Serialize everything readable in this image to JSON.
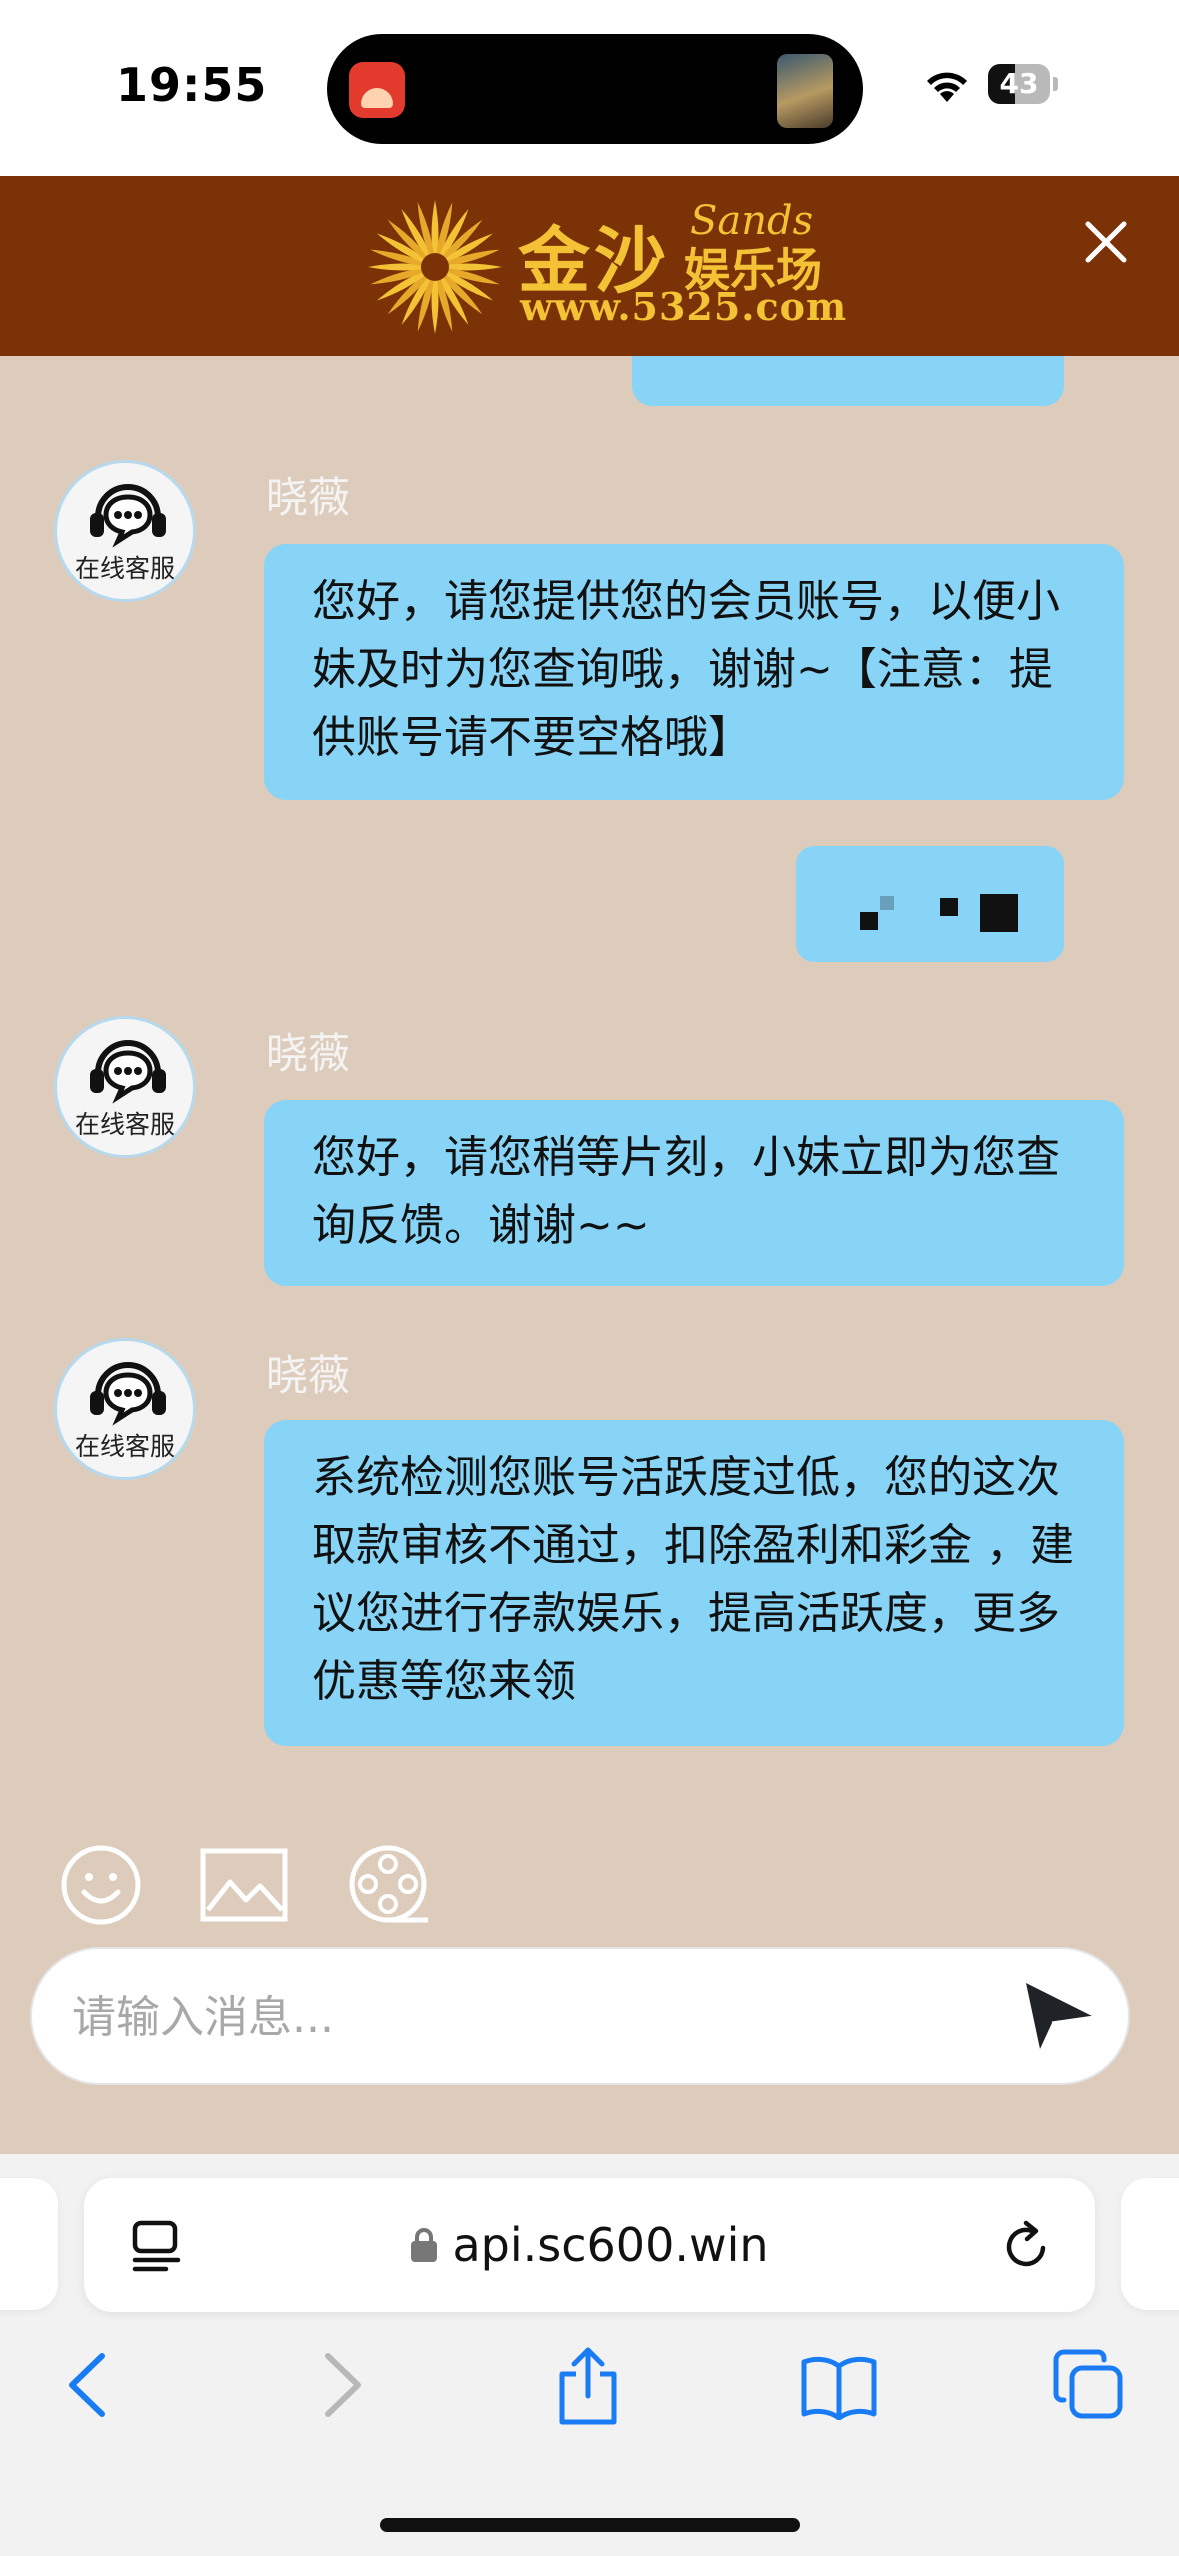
{
  "status_bar": {
    "time": "19:55",
    "battery": "43",
    "battery_level": 0.43,
    "icons": [
      "app-icon",
      "video-thumbnail",
      "wifi-icon",
      "battery-icon"
    ]
  },
  "header": {
    "logo_cn": "金沙",
    "logo_en": "Sands",
    "logo_sub": "娱乐场",
    "logo_url": "www.5325.com",
    "close_icon": "close-icon"
  },
  "colors": {
    "header_bg": "#7b3207",
    "chat_bg": "#ddccbc",
    "bubble": "#87d4f6",
    "logo_gold": "#f3c235"
  },
  "chat": {
    "agent_avatar_label": "在线客服",
    "messages": [
      {
        "from": "agent",
        "name": "晓薇",
        "text": "您好，请您提供您的会员账号，以便小妹及时为您查询哦，谢谢~【注意：提供账号请不要空格哦】"
      },
      {
        "from": "user",
        "text": ""
      },
      {
        "from": "agent",
        "name": "晓薇",
        "text": "您好，请您稍等片刻，小妹立即为您查询反馈。谢谢~~"
      },
      {
        "from": "agent",
        "name": "晓薇",
        "text": "系统检测您账号活跃度过低，您的这次取款审核不通过，扣除盈利和彩金 ，建议您进行存款娱乐，提高活跃度，更多优惠等您来领"
      }
    ]
  },
  "toolbar": {
    "icons": [
      "emoji-icon",
      "image-icon",
      "film-reel-icon"
    ]
  },
  "input": {
    "placeholder": "请输入消息...",
    "value": "",
    "send_icon": "send-icon"
  },
  "browser": {
    "url": "api.sc600.win",
    "icons": [
      "page-menu-icon",
      "lock-icon",
      "reload-icon",
      "back-icon",
      "forward-icon",
      "share-icon",
      "bookmarks-icon",
      "tabs-icon"
    ]
  }
}
